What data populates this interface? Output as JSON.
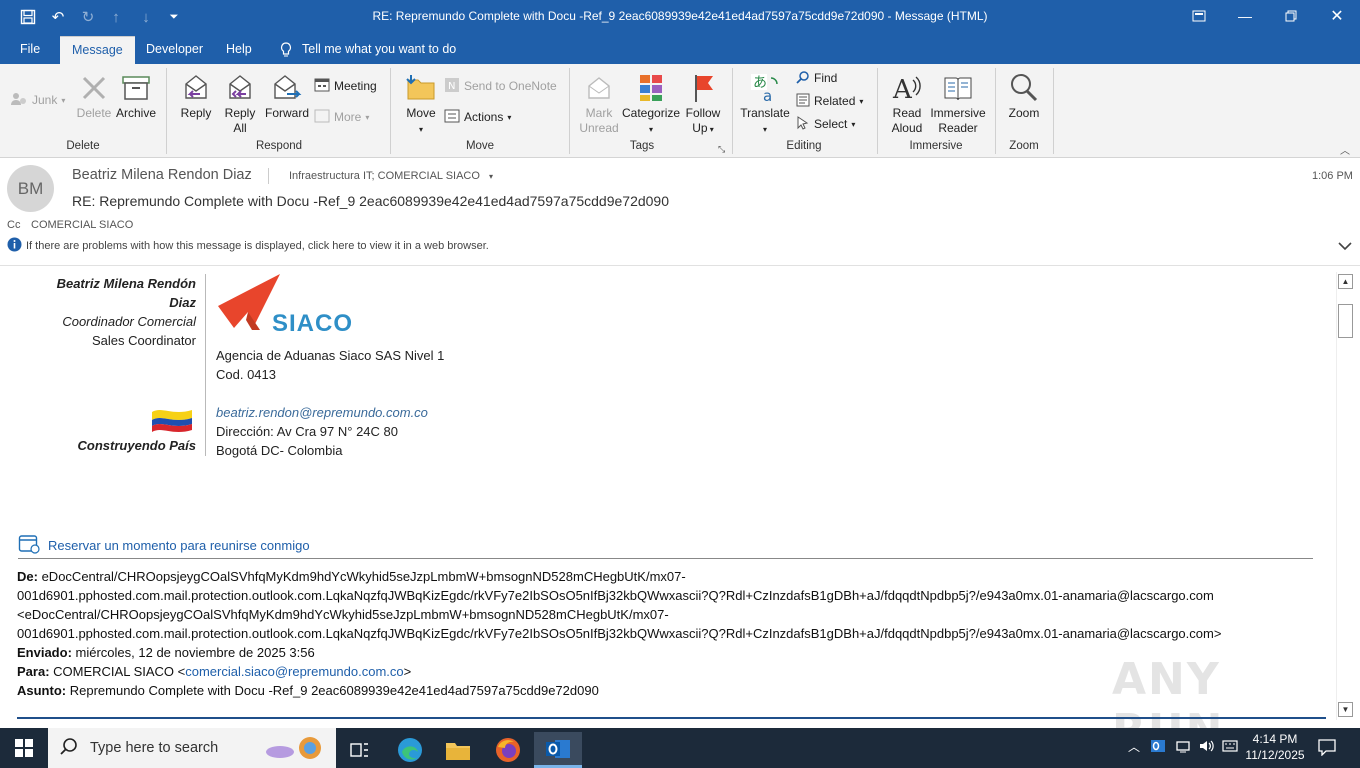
{
  "window": {
    "title": "RE: Repremundo Complete with Docu -Ref_9 2eac6089939e42e41ed4ad7597a75cdd9e72d090  -  Message (HTML)"
  },
  "tabs": [
    "File",
    "Message",
    "Developer",
    "Help"
  ],
  "tell_me": "Tell me what you want to do",
  "ribbon": {
    "delete_group": {
      "junk": "Junk",
      "delete": "Delete",
      "archive": "Archive",
      "label": "Delete"
    },
    "respond_group": {
      "reply": "Reply",
      "reply_all_1": "Reply",
      "reply_all_2": "All",
      "forward": "Forward",
      "meeting": "Meeting",
      "more": "More",
      "label": "Respond"
    },
    "move_group": {
      "move": "Move",
      "onenote": "Send to OneNote",
      "actions": "Actions",
      "label": "Move"
    },
    "tags_group": {
      "mark_unread_1": "Mark",
      "mark_unread_2": "Unread",
      "categorize": "Categorize",
      "follow_up_1": "Follow",
      "follow_up_2": "Up",
      "label": "Tags"
    },
    "editing_group": {
      "translate": "Translate",
      "find": "Find",
      "related": "Related",
      "select": "Select",
      "label": "Editing"
    },
    "immersive_group": {
      "read_aloud_1": "Read",
      "read_aloud_2": "Aloud",
      "immersive_reader_1": "Immersive",
      "immersive_reader_2": "Reader",
      "label": "Immersive"
    },
    "zoom_group": {
      "zoom": "Zoom",
      "label": "Zoom"
    }
  },
  "message": {
    "avatar_initials": "BM",
    "sender": "Beatriz Milena Rendon Diaz",
    "to": "Infraestructura IT; COMERCIAL SIACO",
    "time": "1:06 PM",
    "subject": "RE: Repremundo Complete with Docu -Ref_9 2eac6089939e42e41ed4ad7597a75cdd9e72d090",
    "cc_label": "Cc",
    "cc": "COMERCIAL SIACO",
    "info_bar": "If there are problems with how this message is displayed, click here to view it in a web browser."
  },
  "signature": {
    "name_line1": "Beatriz Milena Rendón",
    "name_line2": "Diaz",
    "role_es": "Coordinador Comercial",
    "role_en": "Sales Coordinator",
    "slogan": "Construyendo País",
    "logo_text": "SIACO",
    "company": "Agencia de Aduanas Siaco SAS Nivel 1",
    "code": "Cod. 0413",
    "email": "beatriz.rendon@repremundo.com.co",
    "address": "Dirección:  Av Cra 97 N° 24C 80",
    "city": "Bogotá DC- Colombia"
  },
  "booking_link": "Reservar un momento para reunirse conmigo",
  "forwarded": {
    "de_label": "De:",
    "de_line1": "eDocCentral/CHROopsjeygCOalSVhfqMyKdm9hdYcWkyhid5seJzpLmbmW+bmsognND528mCHegbUtK/mx07-",
    "de_line2": "001d6901.pphosted.com.mail.protection.outlook.com.LqkaNqzfqJWBqKizEgdc/rkVFy7e2IbSOsO5nIfBj32kbQWwxascii?Q?Rdl+CzInzdafsB1gDBh+aJ/fdqqdtNpdbp5j?/e943a0mx.01-anamaria@lacscargo.com",
    "de_line3": "<eDocCentral/CHROopsjeygCOalSVhfqMyKdm9hdYcWkyhid5seJzpLmbmW+bmsognND528mCHegbUtK/mx07-",
    "de_line4": "001d6901.pphosted.com.mail.protection.outlook.com.LqkaNqzfqJWBqKizEgdc/rkVFy7e2IbSOsO5nIfBj32kbQWwxascii?Q?Rdl+CzInzdafsB1gDBh+aJ/fdqqdtNpdbp5j?/e943a0mx.01-anamaria@lacscargo.com>",
    "enviado_label": "Enviado:",
    "enviado": "miércoles, 12 de noviembre de 2025 3:56",
    "para_label": "Para:",
    "para_name": "COMERCIAL SIACO <",
    "para_email": "comercial.siaco@repremundo.com.co",
    "para_end": ">",
    "asunto_label": "Asunto:",
    "asunto": "Repremundo Complete with Docu -Ref_9 2eac6089939e42e41ed4ad7597a75cdd9e72d090"
  },
  "watermark": "ANY RUN",
  "taskbar": {
    "search_placeholder": "Type here to search",
    "time": "4:14 PM",
    "date": "11/12/2025"
  },
  "colors": {
    "accent": "#1f5faa",
    "taskbar": "#1c2a3a",
    "link": "#1f5faa",
    "logo_red": "#e8452c",
    "logo_blue": "#2f8fc7"
  }
}
